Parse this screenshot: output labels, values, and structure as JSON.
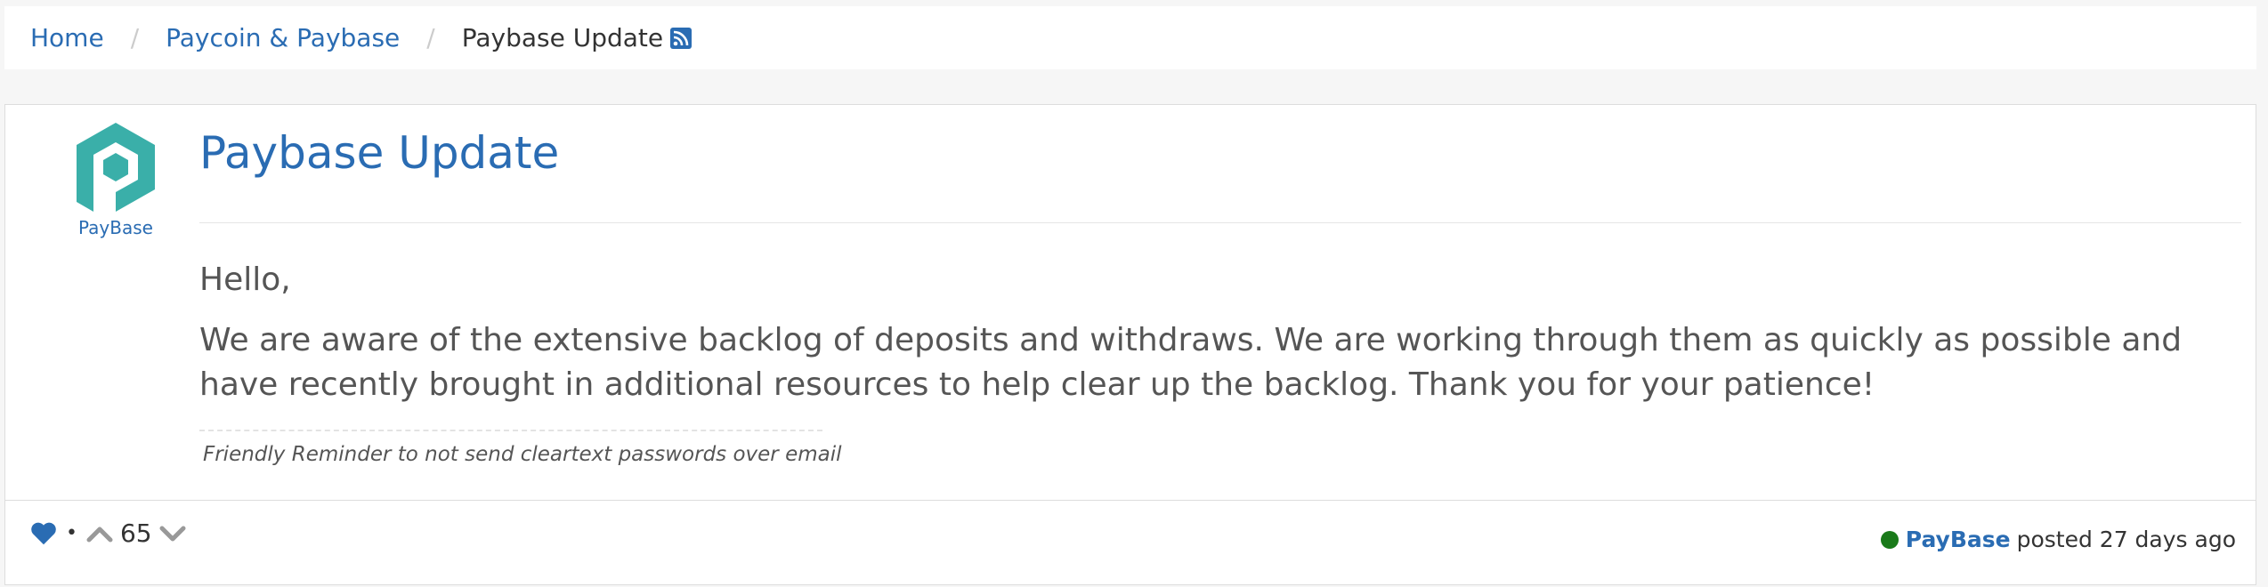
{
  "breadcrumb": {
    "items": [
      {
        "label": "Home"
      },
      {
        "label": "Paycoin & Paybase"
      }
    ],
    "separator": "/",
    "current": "Paybase Update"
  },
  "post": {
    "logo_text": "PayBase",
    "title": "Paybase Update",
    "body": [
      "Hello,",
      "We are aware of the extensive backlog of deposits and withdraws. We are working through them as quickly as possible and have recently brought in additional resources to help clear up the backlog. Thank you for your patience!"
    ],
    "signature": "Friendly Reminder to not send cleartext passwords over email"
  },
  "footer": {
    "dot": "•",
    "vote_count": "65",
    "author": "PayBase",
    "posted_text": "posted 27 days ago",
    "online_status_color": "#1a7a1a"
  },
  "colors": {
    "accent": "#2a6cb3",
    "logo_teal": "#3aafa9"
  },
  "icons": [
    "rss-icon",
    "heart-icon",
    "upvote-chevron-icon",
    "downvote-chevron-icon"
  ]
}
